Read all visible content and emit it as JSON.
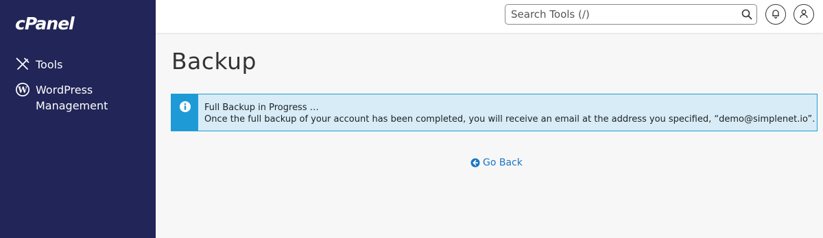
{
  "sidebar": {
    "logo": "cPanel",
    "items": [
      {
        "label": "Tools",
        "icon": "tools-icon"
      },
      {
        "label": "WordPress Management",
        "icon": "wordpress-icon"
      }
    ]
  },
  "header": {
    "search": {
      "placeholder": "Search Tools (/)",
      "icon": "search-icon"
    },
    "notifications_icon": "bell-icon",
    "user_icon": "user-icon"
  },
  "main": {
    "title": "Backup",
    "alert": {
      "icon": "info-icon",
      "heading": "Full Backup in Progress …",
      "message": "Once the full backup of your account has been completed, you will receive an email at the address you specified, “demo@simplenet.io”."
    },
    "go_back": {
      "label": "Go Back",
      "icon": "arrow-left-circle-icon"
    }
  },
  "colors": {
    "sidebar_bg": "#212557",
    "info_accent": "#1e9bd6",
    "info_bg": "#d7ecf7",
    "link": "#1a75c4"
  }
}
